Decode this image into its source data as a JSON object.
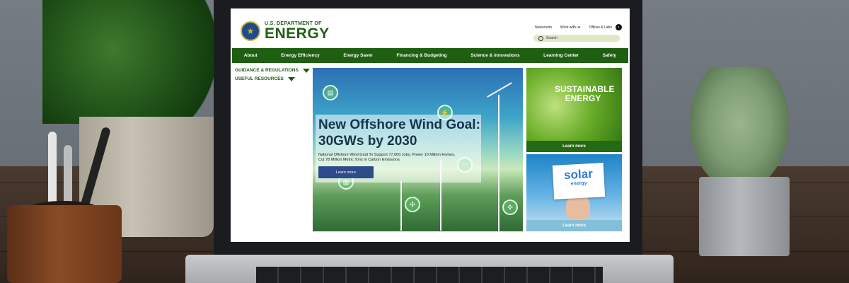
{
  "site": {
    "logo": {
      "line1": "U.S. DEPARTMENT OF",
      "line2": "ENERGY"
    },
    "top_links": [
      "Newsroom",
      "Work with us",
      "Offices & Labs"
    ],
    "search": {
      "placeholder": "Search"
    },
    "nav": [
      "About",
      "Energy Efficiency",
      "Energy Saver",
      "Financing & Budgeting",
      "Science & Innovations",
      "Learning Center",
      "Safety"
    ],
    "sidebar": [
      "GUIDANCE & REGULATIONS",
      "USEFUL RESOURCES"
    ],
    "hero": {
      "title_line1": "New Offshore Wind Goal:",
      "title_line2": "30GWs by 2030",
      "subtitle_line1": "National Offshore Wind Goal To Support 77,000 Jobs, Power 10 Million Homes,",
      "subtitle_line2": "Cut 78 Million Metric Tons in Carbon Emissions",
      "button": "Learn more"
    },
    "cards": [
      {
        "title_line1": "SUSTAINABLE",
        "title_line2": "ENERGY",
        "button": "Learn more"
      },
      {
        "sign_line1": "solar",
        "sign_line2": "energy",
        "button": "Learn more"
      }
    ]
  },
  "colors": {
    "brand_green": "#1f5f12",
    "hero_button": "#2e4b8c",
    "search_bg": "#dfe7c9"
  },
  "icons": [
    "seal-icon",
    "search-icon",
    "chevron-right-icon",
    "dropdown-triangle-icon",
    "network-node-icon"
  ]
}
